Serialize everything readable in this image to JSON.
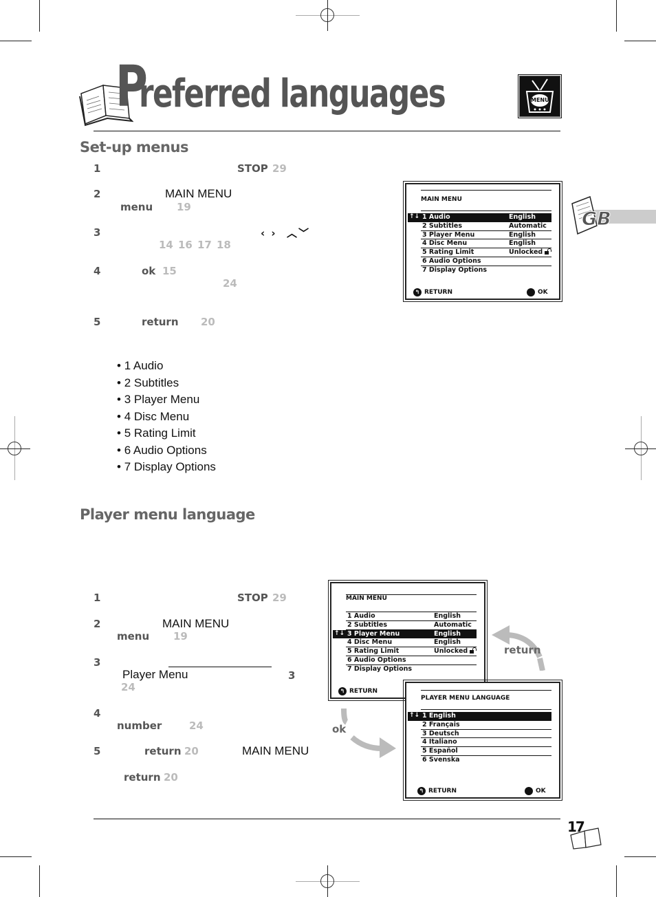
{
  "page": {
    "title_initial": "P",
    "title_rest": "referred languages",
    "page_number": "17",
    "language_tab": "GB",
    "menu_icon_label": "MENU"
  },
  "setup": {
    "heading": "Set-up menus",
    "steps": [
      {
        "num": "1",
        "keyword": "STOP",
        "ref": "29"
      },
      {
        "num": "2",
        "text": "MAIN MENU",
        "keyword": "menu",
        "ref": "19"
      },
      {
        "num": "3",
        "nav_symbols": "‹ ›  ︿ ﹀",
        "refs": [
          "14",
          "16",
          "17",
          "18"
        ]
      },
      {
        "num": "4",
        "keyword": "ok",
        "ref": "15",
        "ref2": "24"
      },
      {
        "num": "5",
        "keyword": "return",
        "ref": "20"
      }
    ],
    "bullets": [
      "1 Audio",
      "2 Subtitles",
      "3 Player Menu",
      "4 Disc Menu",
      "5 Rating Limit",
      "6 Audio Options",
      "7 Display Options"
    ]
  },
  "player_lang": {
    "heading": "Player menu language",
    "steps": [
      {
        "num": "1",
        "keyword": "STOP",
        "ref": "29"
      },
      {
        "num": "2",
        "text": "MAIN MENU",
        "keyword": "menu",
        "ref": "19"
      },
      {
        "num": "3",
        "text": "Player Menu",
        "num_ref": "3",
        "ref": "24"
      },
      {
        "num": "4",
        "keyword": "number",
        "ref": "24"
      },
      {
        "num": "5",
        "keyword": "return",
        "ref": "20",
        "text": "MAIN MENU"
      },
      {
        "keyword": "return",
        "ref": "20"
      }
    ],
    "arrow_ok": "ok",
    "arrow_return": "return"
  },
  "screen1": {
    "title": "MAIN MENU",
    "nav_arrows": "↑↓",
    "selected_index": 0,
    "items": [
      {
        "num": "1",
        "label": "Audio",
        "value": "English"
      },
      {
        "num": "2",
        "label": "Subtitles",
        "value": "Automatic"
      },
      {
        "num": "3",
        "label": "Player Menu",
        "value": "English"
      },
      {
        "num": "4",
        "label": "Disc Menu",
        "value": "English"
      },
      {
        "num": "5",
        "label": "Rating Limit",
        "value": "Unlocked"
      },
      {
        "num": "6",
        "label": "Audio Options",
        "value": ""
      },
      {
        "num": "7",
        "label": "Display Options",
        "value": ""
      }
    ],
    "return_label": "RETURN",
    "ok_label": "OK"
  },
  "screen2": {
    "title": "MAIN MENU",
    "nav_arrows": "↑↓",
    "selected_index": 2,
    "items": [
      {
        "num": "1",
        "label": "Audio",
        "value": "English"
      },
      {
        "num": "2",
        "label": "Subtitles",
        "value": "Automatic"
      },
      {
        "num": "3",
        "label": "Player Menu",
        "value": "English"
      },
      {
        "num": "4",
        "label": "Disc Menu",
        "value": "English"
      },
      {
        "num": "5",
        "label": "Rating Limit",
        "value": "Unlocked"
      },
      {
        "num": "6",
        "label": "Audio Options",
        "value": ""
      },
      {
        "num": "7",
        "label": "Display Options",
        "value": ""
      }
    ],
    "return_label": "RETURN"
  },
  "screen3": {
    "title": "PLAYER MENU LANGUAGE",
    "nav_arrows": "↑↓",
    "selected_index": 0,
    "items": [
      {
        "num": "1",
        "label": "English"
      },
      {
        "num": "2",
        "label": "Français"
      },
      {
        "num": "3",
        "label": "Deutsch"
      },
      {
        "num": "4",
        "label": "Italiano"
      },
      {
        "num": "5",
        "label": "Español"
      },
      {
        "num": "6",
        "label": "Svenska"
      }
    ],
    "return_label": "RETURN",
    "ok_label": "OK"
  }
}
